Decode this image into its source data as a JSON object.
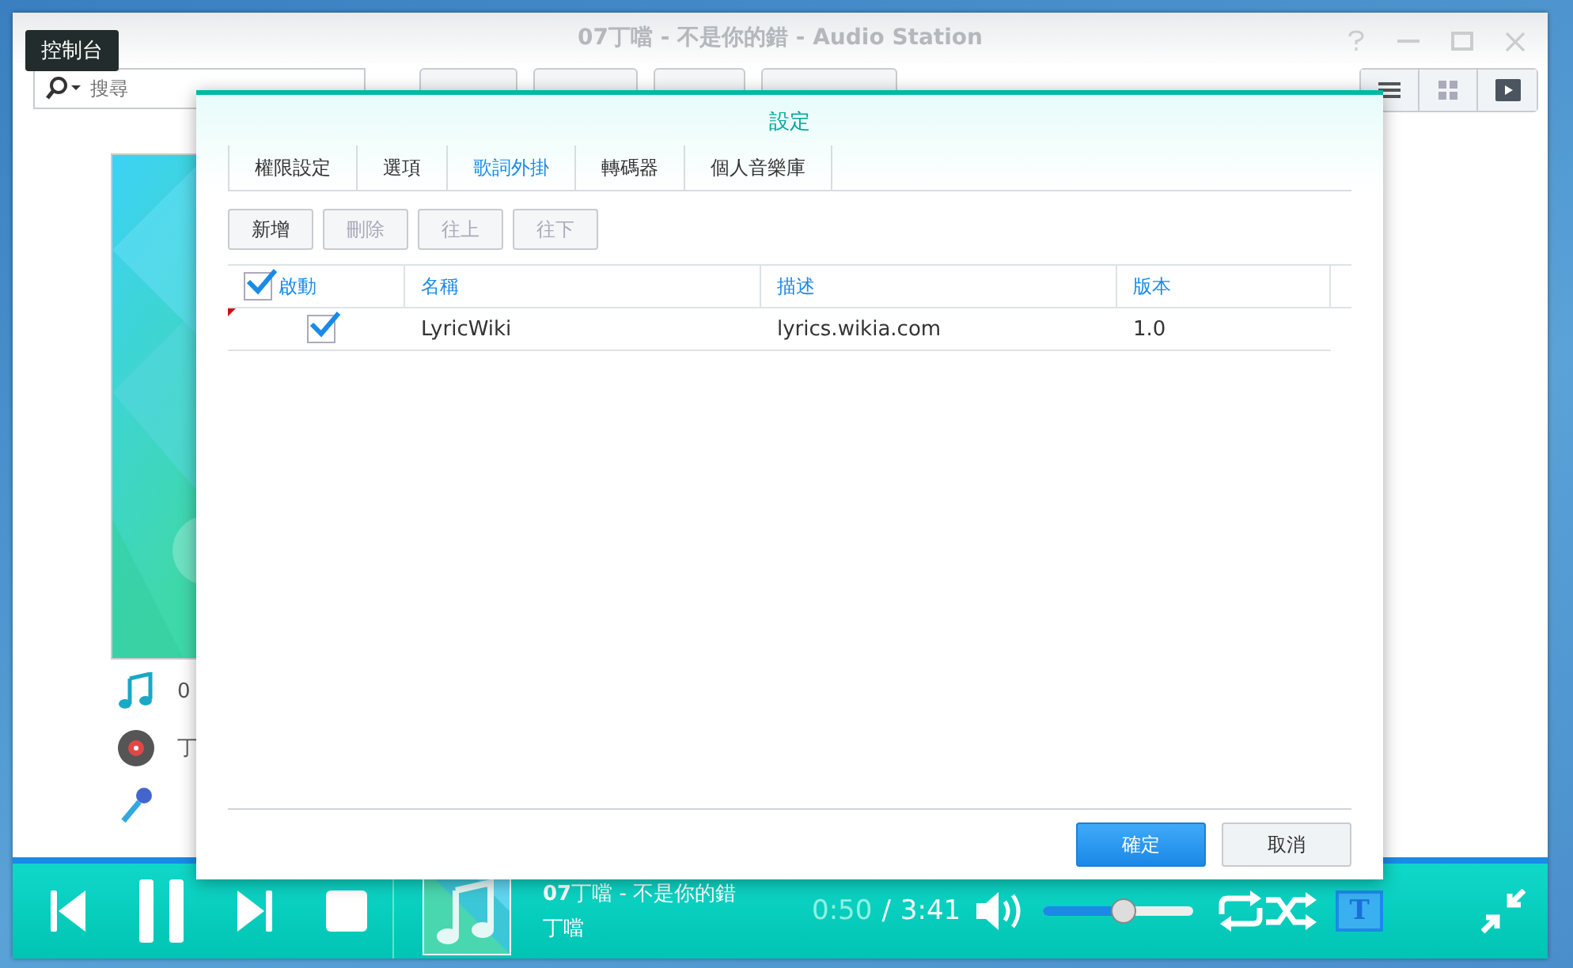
{
  "tooltip": "控制台",
  "window": {
    "title": "07丁噹 - 不是你的錯 - Audio Station"
  },
  "search": {
    "placeholder": "搜尋"
  },
  "info_rows": [
    {
      "kind": "song",
      "text": "0"
    },
    {
      "kind": "album",
      "text": "丁"
    },
    {
      "kind": "artist"
    }
  ],
  "dialog": {
    "title": "設定",
    "tabs": [
      {
        "label": "權限設定",
        "selected": false
      },
      {
        "label": "選項",
        "selected": false
      },
      {
        "label": "歌詞外掛",
        "selected": true
      },
      {
        "label": "轉碼器",
        "selected": false
      },
      {
        "label": "個人音樂庫",
        "selected": false
      }
    ],
    "buttons": [
      {
        "label": "新增",
        "disabled": false
      },
      {
        "label": "刪除",
        "disabled": true
      },
      {
        "label": "往上",
        "disabled": true
      },
      {
        "label": "往下",
        "disabled": true
      }
    ],
    "table": {
      "all_checked": true,
      "columns": [
        "啟動",
        "名稱",
        "描述",
        "版本"
      ],
      "rows": [
        {
          "enabled": true,
          "name": "LyricWiki",
          "description": "lyrics.wikia.com",
          "version": "1.0"
        }
      ]
    },
    "footer": [
      {
        "label": "確定",
        "kind": "primary"
      },
      {
        "label": "取消",
        "kind": "secondary"
      }
    ]
  },
  "player": {
    "title": "**07**丁噹 - 不是你的錯",
    "artist": "丁噹",
    "elapsed": "0:50",
    "separator": "/",
    "duration": "3:41",
    "volume": {
      "level": 0.54
    },
    "lyrics_toggle": {
      "label": "T",
      "on": true
    }
  }
}
